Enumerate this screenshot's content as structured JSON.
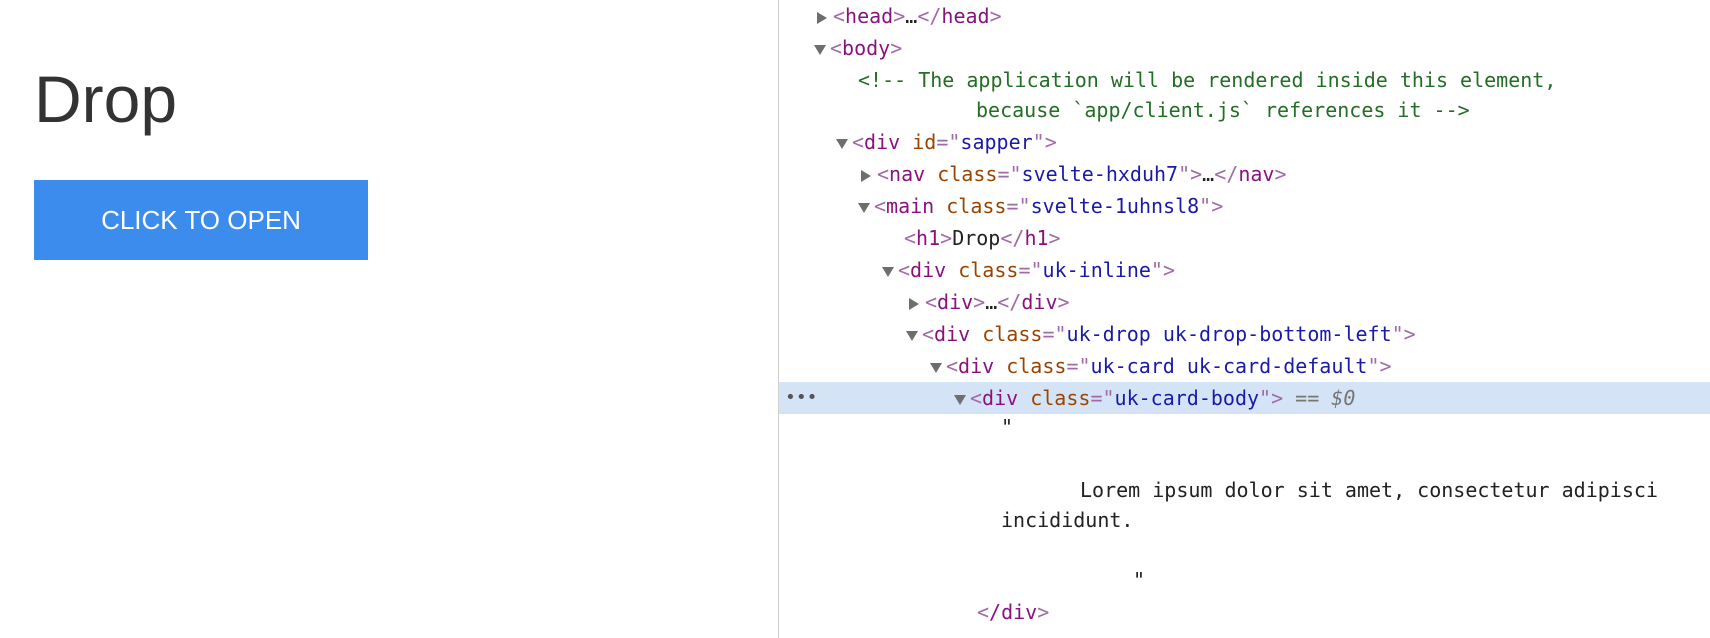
{
  "preview": {
    "title": "Drop",
    "button_label": "CLICK TO OPEN"
  },
  "devtools": {
    "head_tag": "head",
    "ellipsis": "…",
    "body_tag": "body",
    "comment_line1": "<!-- The application will be rendered inside this element,",
    "comment_line2": "because `app/client.js` references it -->",
    "div_tag": "div",
    "nav_tag": "nav",
    "main_tag": "main",
    "h1_tag": "h1",
    "attr_id": "id",
    "attr_class": "class",
    "sapper_id": "sapper",
    "nav_class": "svelte-hxduh7",
    "main_class": "svelte-1uhnsl8",
    "h1_text": "Drop",
    "inline_class": "uk-inline",
    "drop_class": "uk-drop uk-drop-bottom-left",
    "card_class": "uk-card uk-card-default",
    "card_body_class": "uk-card-body",
    "selected_marker": "== $0",
    "row_dots": "•••",
    "quote": "\"",
    "lorem_line1": "Lorem ipsum dolor sit amet, consectetur adipisci",
    "lorem_line2": "incididunt.",
    "close_div": "/div"
  },
  "colors": {
    "button_bg": "#3c8ced",
    "selected_row": "#d5e3f7",
    "tag": "#881280",
    "attr_name": "#994500",
    "attr_value": "#1a1aa6",
    "comment": "#236e25"
  }
}
